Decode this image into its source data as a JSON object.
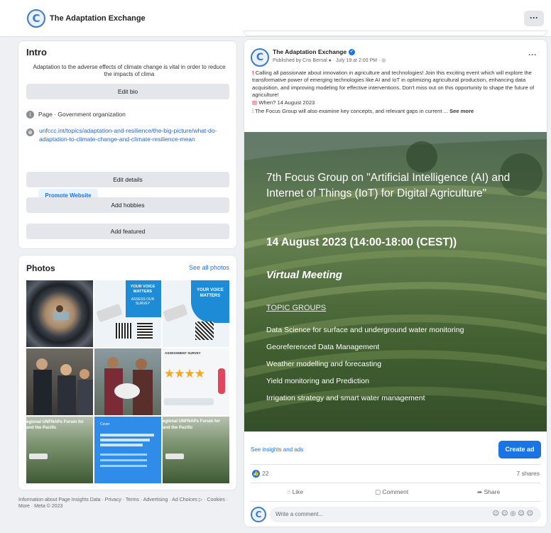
{
  "header": {
    "page_name": "The Adaptation Exchange",
    "more": "···",
    "logo": "C"
  },
  "intro": {
    "title": "Intro",
    "bio": "Adaptation to the adverse effects of climate change is vital in order to reduce the impacts of clima",
    "edit_bio": "Edit bio",
    "page_type": "Page · Government organization",
    "website": "unfccc.int/topics/adaptation-and-resilience/the-big-picture/what-do-adaptation-to-climate-change-and-climate-resilience-mean",
    "promote": "Promote Website",
    "edit_details": "Edit details",
    "add_hobbies": "Add hobbies",
    "add_featured": "Add featured"
  },
  "photos": {
    "title": "Photos",
    "see_all": "See all photos",
    "tiles": [
      {
        "text1": "",
        "text2": ""
      },
      {
        "text1": "YOUR VOICE MATTERS",
        "text2": "ASSESS OUR SURVEY"
      },
      {
        "text1": "YOUR VOICE MATTERS",
        "text2": ""
      },
      {
        "text1": "",
        "text2": ""
      },
      {
        "text1": "",
        "text2": ""
      },
      {
        "text1": "ASSESSMENT SURVEY",
        "text2": "★★★★"
      },
      {
        "text1": "egional UNFNAPs Forum for",
        "text2": "and the Pacific"
      },
      {
        "text1": "Cover",
        "text2": ""
      },
      {
        "text1": "egional UNFNAPs Forum for",
        "text2": "and the Pacific"
      }
    ]
  },
  "footer": "Information about Page Insights Data · Privacy · Terms · Advertising · Ad Choices ▷ · Cookies · More · Meta © 2023",
  "post": {
    "author": "The Adaptation Exchange",
    "verified": "✓",
    "meta": "Published by Cris Bernal ● · July 19 at 2:00 PM · ◎",
    "more": "···",
    "line1_mark": "!",
    "line1": "Calling all passionate about innovation in agriculture and technologies! Join this exciting event which will explore the transformative power of emerging technologies like AI and IoT in optimizing agricultural production, enhancing data acquisition, and improving modeling for effective interventions. Don't miss out on this opportunity to shape the future of agriculture!",
    "line2": "When? 14 August 2023",
    "line3": "The Focus Group will also examine key concepts, and relevant gaps in current ...",
    "see_more": "See more",
    "image": {
      "heading": "7th Focus Group on \"Artificial Intelligence (AI) and Internet of Things (IoT) for Digital Agriculture\"",
      "date": "14 August 2023 (14:00-18:00 (CEST))",
      "meeting": "Virtual Meeting",
      "topic_heading": "TOPIC GROUPS",
      "topics": [
        "Data Science for surface and underground water monitoring",
        "Georeferenced Data Management",
        "Weather modelling and forecasting",
        "Yield monitoring and Prediction",
        "Irrigation strategy and smart water management"
      ]
    },
    "insights": "See insights and ads",
    "create_ad": "Create ad",
    "likes": "22",
    "shares": "7 shares",
    "like": "Like",
    "comment": "Comment",
    "share": "Share",
    "comment_placeholder": "Write a comment...",
    "comment_icons": "☺☺◎☺☺"
  }
}
